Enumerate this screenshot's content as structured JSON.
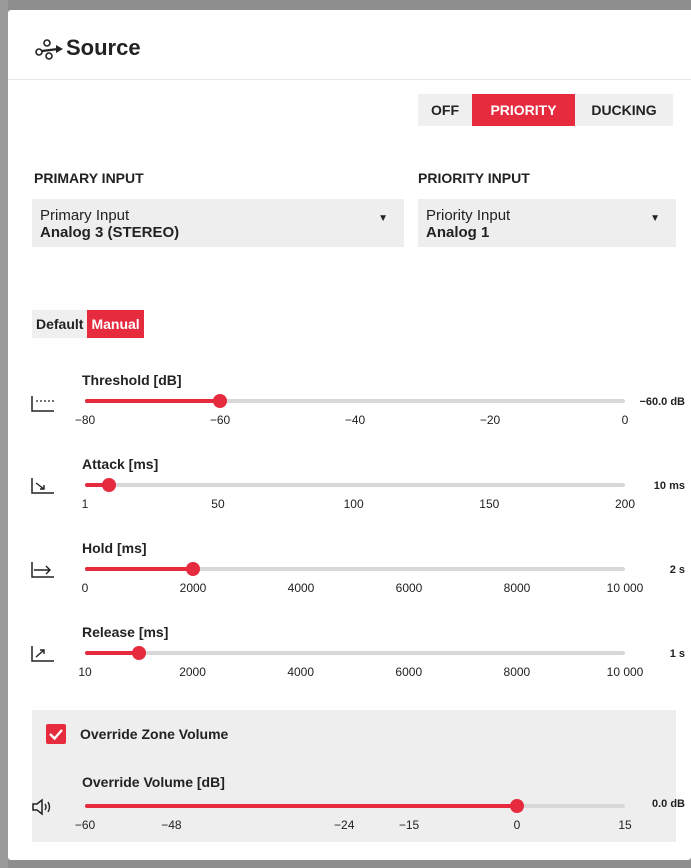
{
  "title": "Source",
  "mode_segments": {
    "off": "OFF",
    "priority": "PRIORITY",
    "ducking": "DUCKING",
    "selected": "PRIORITY"
  },
  "primary": {
    "section_label": "PRIMARY INPUT",
    "field_label": "Primary Input",
    "value": "Analog 3 (STEREO)"
  },
  "priority": {
    "section_label": "PRIORITY INPUT",
    "field_label": "Priority Input",
    "value": "Analog 1"
  },
  "preset_toggle": {
    "default_label": "Default",
    "manual_label": "Manual",
    "selected": "Manual"
  },
  "colors": {
    "accent": "#e52b3d",
    "track": "#d8d8d8",
    "panel_bg": "#ffffff",
    "field_bg": "#eeeeee"
  },
  "sliders": {
    "threshold": {
      "label": "Threshold [dB]",
      "value_text": "−60.0 dB",
      "min": -80,
      "max": 0,
      "value": -60,
      "ticks": [
        "−80",
        "−60",
        "−40",
        "−20",
        "0"
      ],
      "tick_values": [
        -80,
        -60,
        -40,
        -20,
        0
      ],
      "icon": "threshold-icon"
    },
    "attack": {
      "label": "Attack [ms]",
      "value_text": "10 ms",
      "min": 1,
      "max": 200,
      "value": 10,
      "ticks": [
        "1",
        "50",
        "100",
        "150",
        "200"
      ],
      "tick_values": [
        1,
        50,
        100,
        150,
        200
      ],
      "icon": "attack-icon"
    },
    "hold": {
      "label": "Hold [ms]",
      "value_text": "2 s",
      "min": 0,
      "max": 10000,
      "value": 2000,
      "ticks": [
        "0",
        "2000",
        "4000",
        "6000",
        "8000",
        "10 000"
      ],
      "tick_values": [
        0,
        2000,
        4000,
        6000,
        8000,
        10000
      ],
      "icon": "hold-icon"
    },
    "release": {
      "label": "Release [ms]",
      "value_text": "1 s",
      "min": 10,
      "max": 10000,
      "value": 1000,
      "ticks": [
        "10",
        "2000",
        "4000",
        "6000",
        "8000",
        "10 000"
      ],
      "tick_values": [
        10,
        2000,
        4000,
        6000,
        8000,
        10000
      ],
      "icon": "release-icon"
    },
    "override_volume": {
      "label": "Override Volume [dB]",
      "value_text": "0.0 dB",
      "min": -60,
      "max": 15,
      "value": 0,
      "ticks": [
        "−60",
        "−48",
        "−24",
        "−15",
        "0",
        "15"
      ],
      "tick_values": [
        -60,
        -48,
        -24,
        -15,
        0,
        15
      ],
      "icon": "speaker-icon"
    }
  },
  "override_zone": {
    "checkbox_label": "Override Zone Volume",
    "checked": true
  }
}
